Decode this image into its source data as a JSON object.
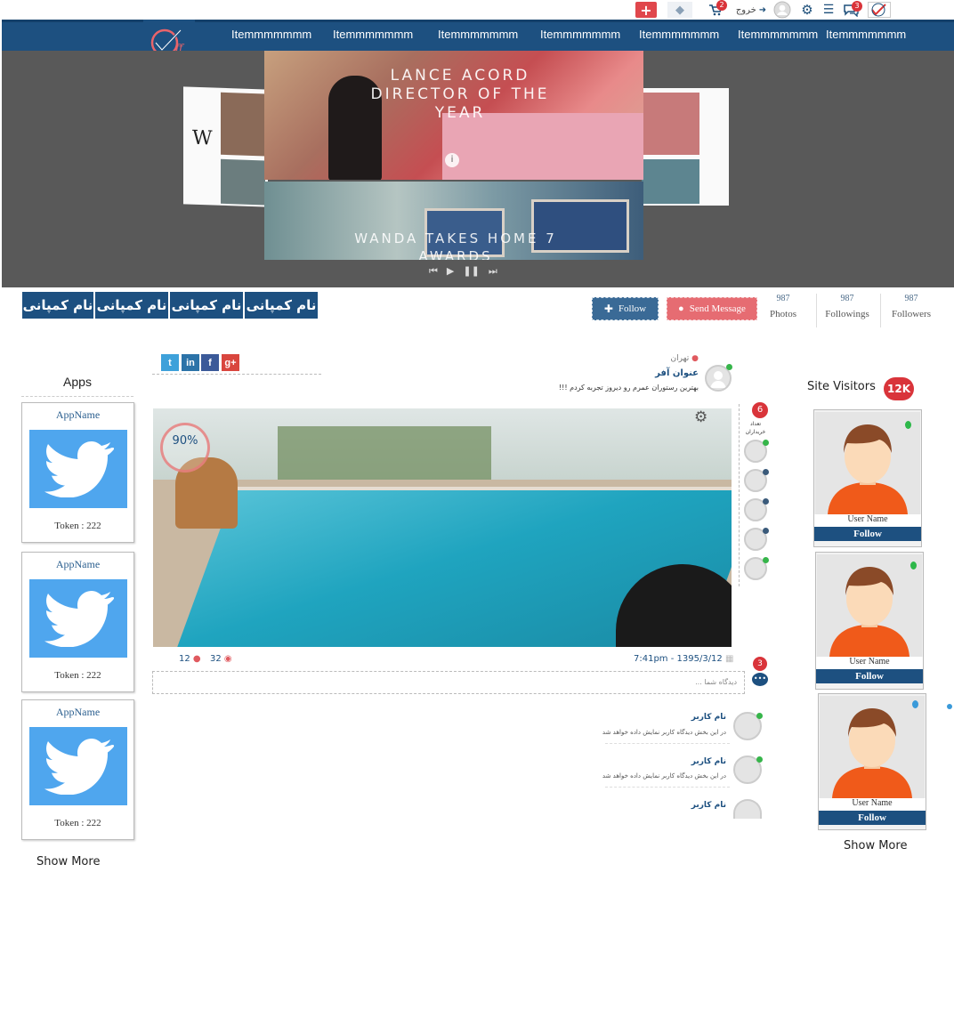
{
  "topbar": {
    "logout_label": "خروج",
    "cart_badge": "2",
    "messages_badge": "3"
  },
  "nav": {
    "items": [
      "Itemmmmmmm",
      "Itemmmmmmm",
      "Itemmmmmmm",
      "Itemmmmmmm",
      "Itemmmmmmm",
      "Itemmmmmmm",
      "Itemmmmmmm"
    ]
  },
  "hero": {
    "slide1_text": "LANCE ACORD DIRECTOR OF THE YEAR",
    "slide2_text": "WANDA TAKES HOME 7 AWARDS",
    "side_logo": "W"
  },
  "company_tabs": [
    "نام کمپانی",
    "نام کمپانی",
    "نام کمپانی",
    "نام کمپانی"
  ],
  "profile_actions": {
    "follow_label": "Follow",
    "send_message_label": "Send Message"
  },
  "stats": [
    {
      "value": "987",
      "label": "Photos"
    },
    {
      "value": "987",
      "label": "Followings"
    },
    {
      "value": "987",
      "label": "Followers"
    }
  ],
  "apps": {
    "title": "Apps",
    "items": [
      {
        "name": "AppName",
        "token": "Token : 222"
      },
      {
        "name": "AppName",
        "token": "Token : 222"
      },
      {
        "name": "AppName",
        "token": "Token : 222"
      }
    ],
    "show_more": "Show More"
  },
  "post": {
    "location": "تهران",
    "title": "عنوان آفر",
    "text": "بهترین رستوران عمرم رو دیروز تجربه کردم !!!",
    "rating_percent": "90%",
    "buyers_count": "6",
    "buyers_label": "تعداد خریداران",
    "comments_count": "12",
    "views_count": "32",
    "datetime": "7:41pm - 1395/3/12",
    "comment_badge": "3",
    "comment_placeholder": "دیدگاه شما ..."
  },
  "comments": [
    {
      "user": "نام کاربر",
      "text": "در این بخش دیدگاه کاربر نمایش داده خواهد شد"
    },
    {
      "user": "نام کاربر",
      "text": "در این بخش دیدگاه کاربر نمایش داده خواهد شد"
    },
    {
      "user": "نام کاربر",
      "text": ""
    }
  ],
  "visitors": {
    "title": "Site Visitors",
    "count_badge": "12K",
    "cards": [
      {
        "username": "User Name",
        "follow_label": "Follow",
        "status_color": "#2eb84a"
      },
      {
        "username": "User Name",
        "follow_label": "Follow",
        "status_color": "#2eb84a"
      },
      {
        "username": "User Name",
        "follow_label": "Follow",
        "status_color": "#3a9ad9"
      }
    ],
    "show_more": "Show More"
  },
  "colors": {
    "brand_blue": "#1d5080",
    "accent_red": "#d9343a",
    "twitter_blue": "#4fa6ee"
  }
}
